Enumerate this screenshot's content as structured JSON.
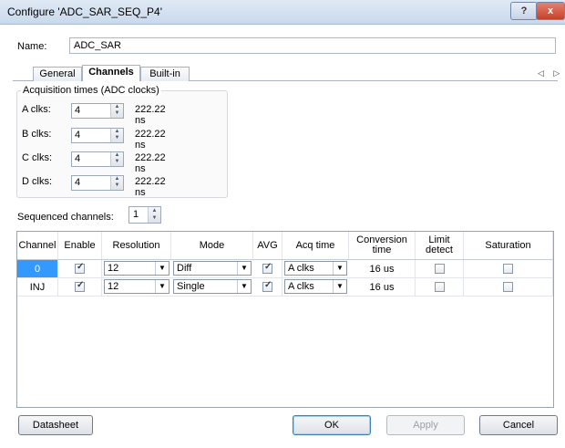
{
  "window": {
    "title": "Configure 'ADC_SAR_SEQ_P4'",
    "help_label": "?",
    "close_label": "x"
  },
  "name": {
    "label": "Name:",
    "value": "ADC_SAR"
  },
  "tabs": [
    {
      "label": "General"
    },
    {
      "label": "Channels",
      "active": true
    },
    {
      "label": "Built-in"
    }
  ],
  "tab_scroll": "◁ ▷",
  "acquisition": {
    "title": "Acquisition times (ADC clocks)",
    "rows": [
      {
        "label": "A clks:",
        "value": "4",
        "time": "222.22 ns"
      },
      {
        "label": "B clks:",
        "value": "4",
        "time": "222.22 ns"
      },
      {
        "label": "C clks:",
        "value": "4",
        "time": "222.22 ns"
      },
      {
        "label": "D clks:",
        "value": "4",
        "time": "222.22 ns"
      }
    ]
  },
  "sequenced": {
    "label": "Sequenced channels:",
    "value": "1"
  },
  "table": {
    "headers": [
      "Channel",
      "Enable",
      "Resolution",
      "Mode",
      "AVG",
      "Acq time",
      "Conversion time",
      "Limit detect",
      "Saturation"
    ],
    "rows": [
      {
        "channel": "0",
        "enable": true,
        "resolution": "12",
        "mode": "Diff",
        "avg": true,
        "acq": "A clks",
        "conversion": "16 us",
        "limit": false,
        "saturation": false,
        "selected": true
      },
      {
        "channel": "INJ",
        "enable": true,
        "resolution": "12",
        "mode": "Single",
        "avg": true,
        "acq": "A clks",
        "conversion": "16 us",
        "limit": false,
        "saturation": false,
        "selected": false
      }
    ]
  },
  "buttons": {
    "datasheet": "Datasheet",
    "ok": "OK",
    "apply": "Apply",
    "cancel": "Cancel"
  },
  "colors": {
    "selection": "#3399ff",
    "titlebar": "#c9d9ec",
    "close": "#c6412a"
  }
}
